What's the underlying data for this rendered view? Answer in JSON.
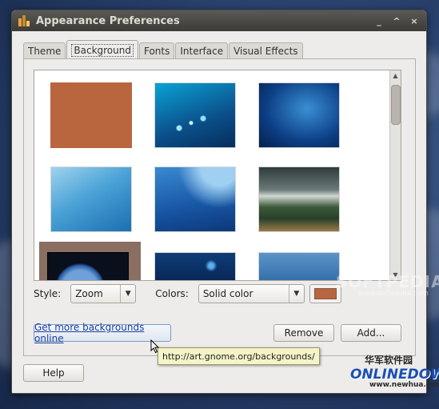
{
  "window": {
    "title": "Appearance Preferences"
  },
  "titlebar": {
    "minimize": "_",
    "maximize": "^",
    "close": "×"
  },
  "tabs": [
    {
      "label": "Theme"
    },
    {
      "label": "Background"
    },
    {
      "label": "Fonts"
    },
    {
      "label": "Interface"
    },
    {
      "label": "Visual Effects"
    }
  ],
  "wallpapers": [
    {
      "name": "solid-brown"
    },
    {
      "name": "blue-bokeh"
    },
    {
      "name": "deep-blue"
    },
    {
      "name": "light-blue-waves"
    },
    {
      "name": "blue-curves"
    },
    {
      "name": "mountain-landscape"
    },
    {
      "name": "earth-from-space"
    },
    {
      "name": "dark-blue-sparkle"
    },
    {
      "name": "soft-blue"
    }
  ],
  "style": {
    "label": "Style:",
    "value": "Zoom"
  },
  "colors": {
    "label": "Colors:",
    "value": "Solid color",
    "swatch": "#b9653e"
  },
  "buttons": {
    "get_more": "Get more backgrounds online",
    "remove": "Remove",
    "add": "Add...",
    "help": "Help"
  },
  "tooltip": {
    "text": "http://art.gnome.org/backgrounds/"
  },
  "watermarks": {
    "softpedia": "SOFTPEDIA",
    "softpedia_url": "www.softpedia.com",
    "site_cn": "华军软件园",
    "site_logo": "ONLINEDOWN",
    "site_url": "www.newhua.com"
  }
}
